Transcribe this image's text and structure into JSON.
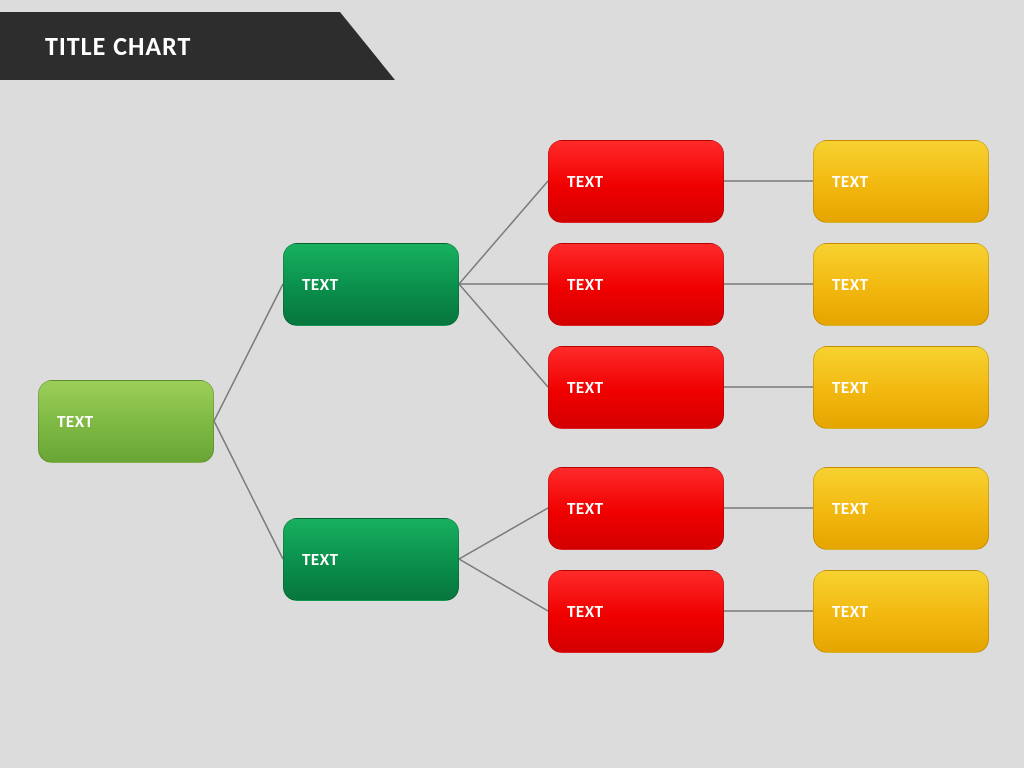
{
  "title": "TITLE CHART",
  "root": {
    "label": "TEXT"
  },
  "level1": [
    {
      "label": "TEXT"
    },
    {
      "label": "TEXT"
    }
  ],
  "level2": [
    {
      "label": "TEXT"
    },
    {
      "label": "TEXT"
    },
    {
      "label": "TEXT"
    },
    {
      "label": "TEXT"
    },
    {
      "label": "TEXT"
    }
  ],
  "level3": [
    {
      "label": "TEXT"
    },
    {
      "label": "TEXT"
    },
    {
      "label": "TEXT"
    },
    {
      "label": "TEXT"
    },
    {
      "label": "TEXT"
    }
  ]
}
